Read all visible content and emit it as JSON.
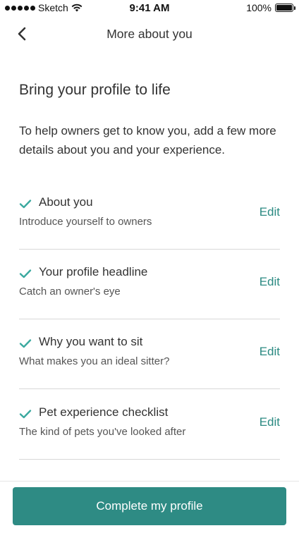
{
  "status_bar": {
    "carrier": "Sketch",
    "time": "9:41 AM",
    "battery": "100%"
  },
  "nav": {
    "title": "More about you"
  },
  "heading": "Bring your profile to life",
  "intro": "To help owners get to know you, add a few more details about you and your experience.",
  "items": [
    {
      "title": "About you",
      "subtitle": "Introduce yourself to owners",
      "edit": "Edit"
    },
    {
      "title": "Your profile headline",
      "subtitle": "Catch an owner's eye",
      "edit": "Edit"
    },
    {
      "title": "Why you want to sit",
      "subtitle": "What makes you an ideal sitter?",
      "edit": "Edit"
    },
    {
      "title": "Pet experience checklist",
      "subtitle": "The kind of pets you've looked after",
      "edit": "Edit"
    }
  ],
  "cta": {
    "label": "Complete my profile"
  },
  "colors": {
    "accent": "#2e8b84",
    "link": "#2b8a82",
    "check": "#3aa99f"
  }
}
